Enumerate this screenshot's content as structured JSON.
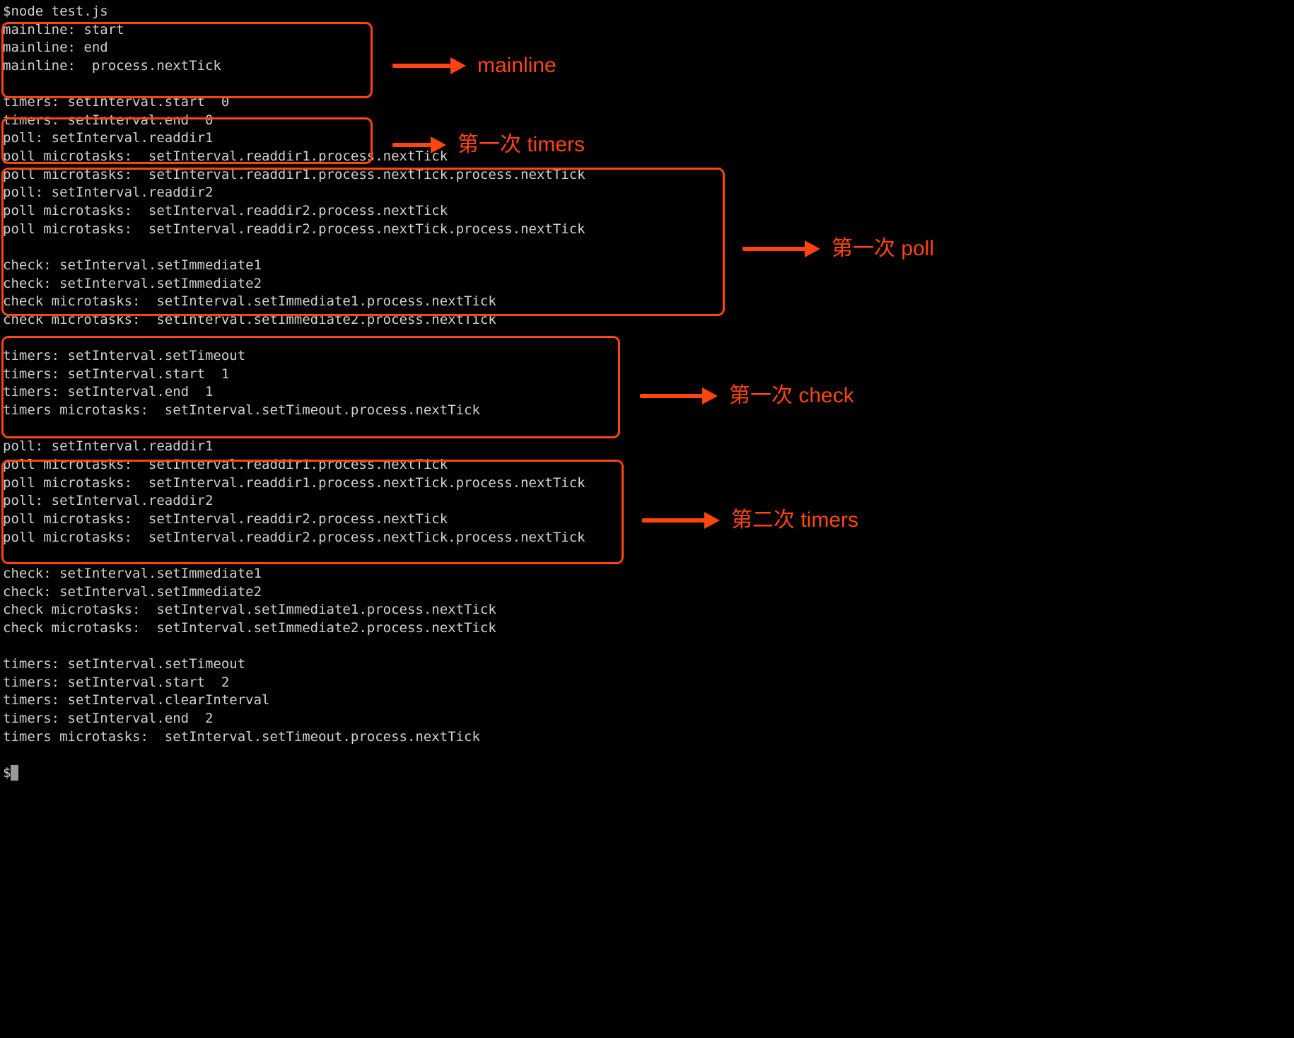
{
  "prompt_start": "$node test.js",
  "prompt_end": "$",
  "blocks": {
    "mainline": [
      "mainline: start",
      "mainline: end",
      "mainline:  process.nextTick"
    ],
    "timers1": [
      "timers: setInterval.start  0",
      "timers: setInterval.end  0"
    ],
    "poll1": [
      "poll: setInterval.readdir1",
      "poll microtasks:  setInterval.readdir1.process.nextTick",
      "poll microtasks:  setInterval.readdir1.process.nextTick.process.nextTick",
      "poll: setInterval.readdir2",
      "poll microtasks:  setInterval.readdir2.process.nextTick",
      "poll microtasks:  setInterval.readdir2.process.nextTick.process.nextTick"
    ],
    "check1": [
      "check: setInterval.setImmediate1",
      "check: setInterval.setImmediate2",
      "check microtasks:  setInterval.setImmediate1.process.nextTick",
      "check microtasks:  setInterval.setImmediate2.process.nextTick"
    ],
    "timers2": [
      "timers: setInterval.setTimeout",
      "timers: setInterval.start  1",
      "timers: setInterval.end  1",
      "timers microtasks:  setInterval.setTimeout.process.nextTick"
    ],
    "poll2": [
      "poll: setInterval.readdir1",
      "poll microtasks:  setInterval.readdir1.process.nextTick",
      "poll microtasks:  setInterval.readdir1.process.nextTick.process.nextTick",
      "poll: setInterval.readdir2",
      "poll microtasks:  setInterval.readdir2.process.nextTick",
      "poll microtasks:  setInterval.readdir2.process.nextTick.process.nextTick"
    ],
    "check2": [
      "check: setInterval.setImmediate1",
      "check: setInterval.setImmediate2",
      "check microtasks:  setInterval.setImmediate1.process.nextTick",
      "check microtasks:  setInterval.setImmediate2.process.nextTick"
    ],
    "timers3": [
      "timers: setInterval.setTimeout",
      "timers: setInterval.start  2",
      "timers: setInterval.clearInterval",
      "timers: setInterval.end  2",
      "timers microtasks:  setInterval.setTimeout.process.nextTick"
    ]
  },
  "annotations": {
    "mainline": "mainline",
    "timers1": "第一次 timers",
    "poll1": "第一次 poll",
    "check1": "第一次 check",
    "timers2": "第二次 timers"
  },
  "colors": {
    "annotation": "#ff4410",
    "terminal_fg": "#d0d0d0",
    "terminal_bg": "#000000"
  }
}
